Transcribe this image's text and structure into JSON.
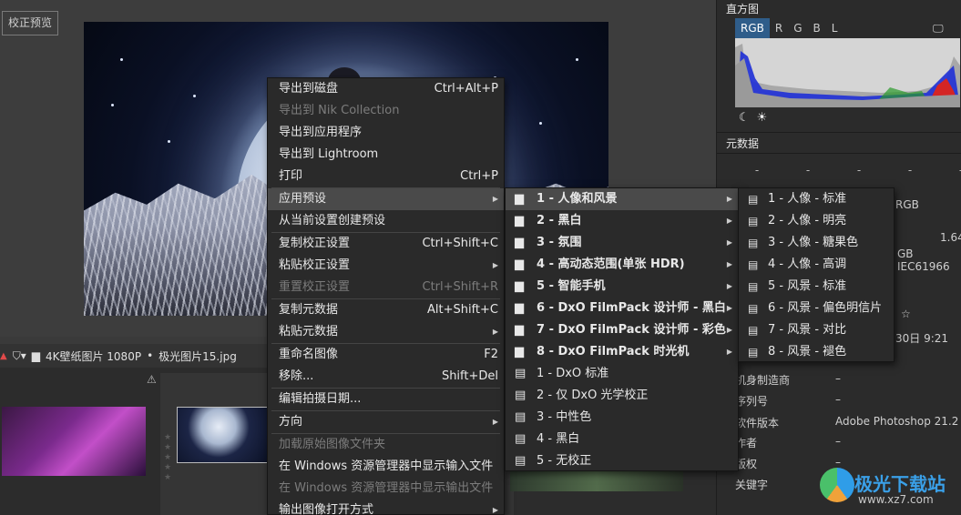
{
  "viewer": {
    "preview_button": "校正预览"
  },
  "filmbar": {
    "folder": "4K壁纸图片 1080P",
    "separator": "•",
    "file": "极光图片15.jpg"
  },
  "right_panel": {
    "histogram_title": "直方图",
    "channels": [
      "RGB",
      "R",
      "G",
      "B",
      "L"
    ],
    "active_channel": "RGB",
    "metadata_title": "元数据",
    "dashes": [
      "-",
      "-",
      "-",
      "-",
      "-"
    ],
    "meta_partial": {
      "rgb": "RGB",
      "value_164": "1.64",
      "profile": "GB IEC61966",
      "date": "30日 9:21",
      "star": "☆"
    },
    "meta_rows": [
      {
        "label": "机身制造商",
        "value": "–"
      },
      {
        "label": "序列号",
        "value": "–"
      },
      {
        "label": "软件版本",
        "value": "Adobe Photoshop 21.2"
      },
      {
        "label": "作者",
        "value": "–"
      },
      {
        "label": "版权",
        "value": "–"
      },
      {
        "label": "关键字",
        "value": ""
      }
    ]
  },
  "menu1": {
    "items": [
      {
        "label": "导出到磁盘",
        "shortcut": "Ctrl+Alt+P",
        "disabled": false
      },
      {
        "label": "导出到 Nik Collection",
        "shortcut": "",
        "disabled": true
      },
      {
        "label": "导出到应用程序",
        "shortcut": "",
        "disabled": false
      },
      {
        "label": "导出到 Lightroom",
        "shortcut": "",
        "disabled": false
      },
      {
        "label": "打印",
        "shortcut": "Ctrl+P",
        "disabled": false
      },
      {
        "label": "应用预设",
        "shortcut": "",
        "disabled": false
      },
      {
        "label": "从当前设置创建预设",
        "shortcut": "",
        "disabled": false
      },
      {
        "label": "复制校正设置",
        "shortcut": "Ctrl+Shift+C",
        "disabled": false
      },
      {
        "label": "粘贴校正设置",
        "shortcut": "",
        "disabled": false
      },
      {
        "label": "重置校正设置",
        "shortcut": "Ctrl+Shift+R",
        "disabled": true
      },
      {
        "label": "复制元数据",
        "shortcut": "Alt+Shift+C",
        "disabled": false
      },
      {
        "label": "粘贴元数据",
        "shortcut": "",
        "disabled": false
      },
      {
        "label": "重命名图像",
        "shortcut": "F2",
        "disabled": false
      },
      {
        "label": "移除...",
        "shortcut": "Shift+Del",
        "disabled": false
      },
      {
        "label": "编辑拍摄日期...",
        "shortcut": "",
        "disabled": false
      },
      {
        "label": "方向",
        "shortcut": "",
        "disabled": false
      },
      {
        "label": "加载原始图像文件夹",
        "shortcut": "",
        "disabled": true
      },
      {
        "label": "在 Windows 资源管理器中显示输入文件",
        "shortcut": "",
        "disabled": false
      },
      {
        "label": "在 Windows 资源管理器中显示输出文件",
        "shortcut": "",
        "disabled": true
      },
      {
        "label": "输出图像打开方式",
        "shortcut": "",
        "disabled": false
      }
    ]
  },
  "menu2": {
    "items": [
      {
        "label": "1 - 人像和风景"
      },
      {
        "label": "2 - 黑白"
      },
      {
        "label": "3 - 氛围"
      },
      {
        "label": "4 - 高动态范围(单张 HDR)"
      },
      {
        "label": "5 - 智能手机"
      },
      {
        "label": "6 - DxO FilmPack 设计师 - 黑白"
      },
      {
        "label": "7 - DxO FilmPack 设计师 - 彩色"
      },
      {
        "label": "8 - DxO FilmPack 时光机"
      },
      {
        "label": "1 - DxO 标准"
      },
      {
        "label": "2 - 仅 DxO 光学校正"
      },
      {
        "label": "3 - 中性色"
      },
      {
        "label": "4 - 黑白"
      },
      {
        "label": "5 - 无校正"
      }
    ]
  },
  "menu3": {
    "items": [
      {
        "label": "1 - 人像 - 标准"
      },
      {
        "label": "2 - 人像 - 明亮"
      },
      {
        "label": "3 - 人像 - 糖果色"
      },
      {
        "label": "4 - 人像 - 高调"
      },
      {
        "label": "5 - 风景 - 标准"
      },
      {
        "label": "6 - 风景 - 偏色明信片"
      },
      {
        "label": "7 - 风景 - 对比"
      },
      {
        "label": "8 - 风景 - 褪色"
      }
    ]
  },
  "watermark": {
    "brand": "极光下载站",
    "url": "www.xz7.com"
  }
}
